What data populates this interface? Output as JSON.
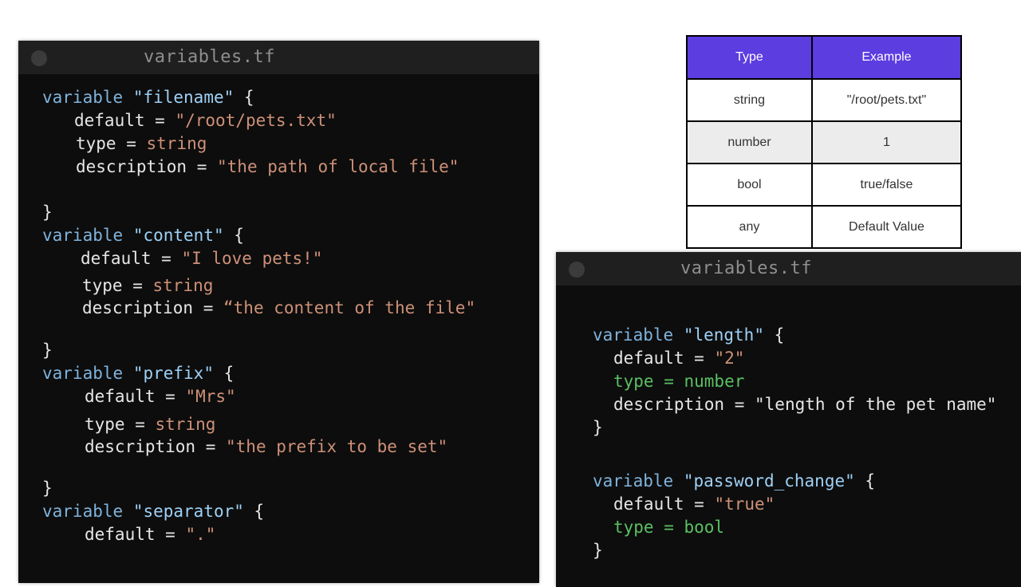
{
  "left_editor": {
    "title": "variables.tf",
    "blocks": [
      {
        "keyword": "variable",
        "name": "\"filename\"",
        "open": " {",
        "default_key": "default = ",
        "default_val": "\"/root/pets.txt\"",
        "type_key": "type = ",
        "type_val": "string",
        "desc_key": "description = ",
        "desc_val": "\"the path of local file\"",
        "close": "}"
      },
      {
        "keyword": "variable",
        "name": "\"content\"",
        "open": " {",
        "default_key": "default = ",
        "default_val": "\"I love pets!\"",
        "type_key": "type = ",
        "type_val": "string",
        "desc_key": "description = ",
        "desc_val": "“the content of the file\"",
        "close": "}"
      },
      {
        "keyword": "variable",
        "name": "\"prefix\"",
        "open": " {",
        "default_key": "default = ",
        "default_val": "\"Mrs\"",
        "type_key": "type = ",
        "type_val": "string",
        "desc_key": "description = ",
        "desc_val": "\"the prefix to be set\"",
        "close": "}"
      },
      {
        "keyword": "variable",
        "name": "\"separator\"",
        "open": " {",
        "default_key": "default = ",
        "default_val": "\".\""
      }
    ]
  },
  "right_editor": {
    "title": "variables.tf",
    "blocks": [
      {
        "keyword": "variable",
        "name": "\"length\"",
        "open": " {",
        "default_key": "default = ",
        "default_val": "\"2\"",
        "type_line": "type = number",
        "desc_key": "description = ",
        "desc_val": "\"length of the pet name\"",
        "close": "}"
      },
      {
        "keyword": "variable",
        "name": "\"password_change\"",
        "open": " {",
        "default_key": "default = ",
        "default_val": "\"true\"",
        "type_line": "type = bool",
        "close": "}"
      }
    ]
  },
  "type_table": {
    "headers": [
      "Type",
      "Example"
    ],
    "rows": [
      [
        "string",
        "\"/root/pets.txt\""
      ],
      [
        "number",
        "1"
      ],
      [
        "bool",
        "true/false"
      ],
      [
        "any",
        "Default Value"
      ]
    ],
    "header_color": "#5b3de0"
  }
}
